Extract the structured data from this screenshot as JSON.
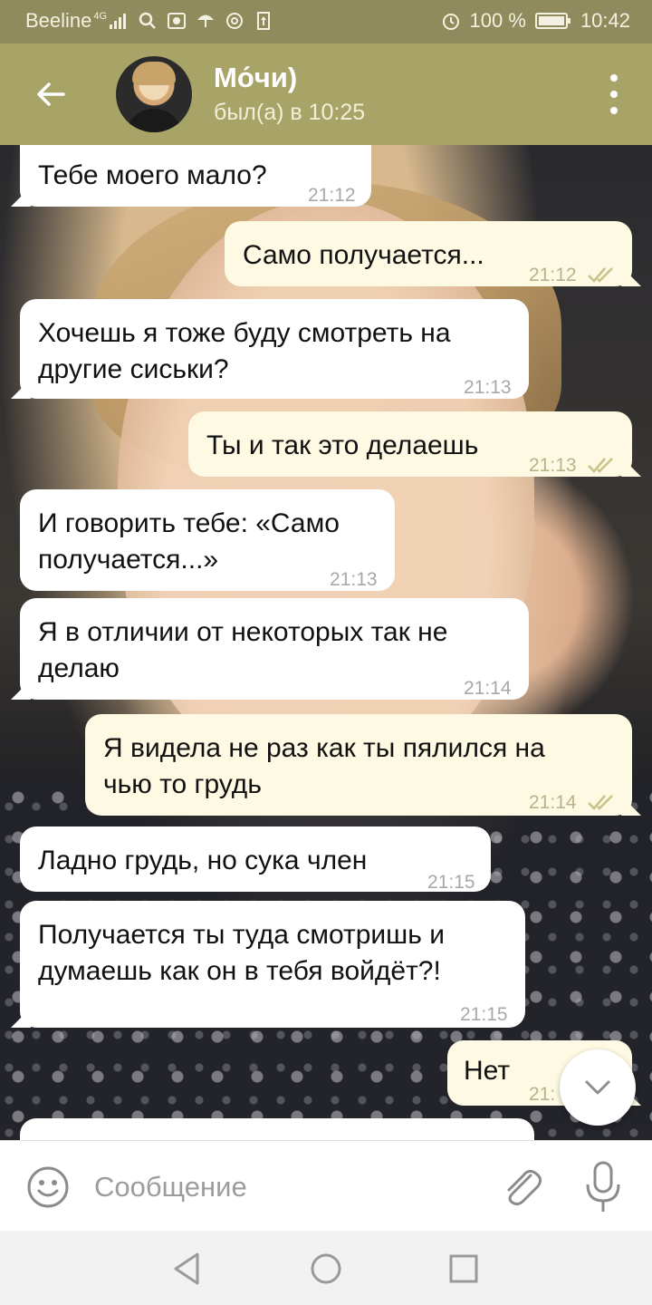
{
  "status_bar": {
    "carrier": "Beeline",
    "network": "4G",
    "battery": "100 %",
    "time": "10:42",
    "icons": [
      "signal-icon",
      "search-icon",
      "gallery-icon",
      "umbrella-icon",
      "at-icon",
      "upload-icon",
      "alarm-icon",
      "battery-icon"
    ]
  },
  "header": {
    "contact_name": "Мо́чи)",
    "contact_status": "был(а) в 10:25",
    "icons": [
      "back-arrow-icon",
      "avatar",
      "more-vert-icon"
    ]
  },
  "messages": [
    {
      "direction": "in",
      "lines": [
        "Тебе моего мало?"
      ],
      "time": "21:12"
    },
    {
      "direction": "out",
      "lines": [
        "Само получается..."
      ],
      "time": "21:12",
      "read": true
    },
    {
      "direction": "in",
      "lines": [
        "Хочешь я тоже буду смотреть на",
        "другие сиськи?"
      ],
      "time": "21:13"
    },
    {
      "direction": "out",
      "lines": [
        "Ты и так это делаешь"
      ],
      "time": "21:13",
      "read": true
    },
    {
      "direction": "in",
      "lines": [
        "И говорить тебе: «Само",
        "получается...»"
      ],
      "time": "21:13"
    },
    {
      "direction": "in",
      "lines": [
        "Я в отличии от некоторых так не",
        "делаю"
      ],
      "time": "21:14"
    },
    {
      "direction": "out",
      "lines": [
        "Я видела не раз как ты пялился на",
        "чью то грудь"
      ],
      "time": "21:14",
      "read": true
    },
    {
      "direction": "in",
      "lines": [
        "Ладно грудь, но сука член"
      ],
      "time": "21:15"
    },
    {
      "direction": "in",
      "lines": [
        "Получается ты туда смотришь и",
        "думаешь как он в тебя войдёт?!"
      ],
      "time": "21:15"
    },
    {
      "direction": "out",
      "lines": [
        "Нет"
      ],
      "time": "21:"
    }
  ],
  "composer": {
    "placeholder": "Сообщение",
    "icons": [
      "emoji-icon",
      "paperclip-icon",
      "mic-icon"
    ]
  },
  "colors": {
    "status_bar": "#8f8b5c",
    "header": "#a8a468",
    "incoming_bubble": "#ffffff",
    "outgoing_bubble": "#fdf9e2",
    "read_ticks": "#c9c28a"
  }
}
